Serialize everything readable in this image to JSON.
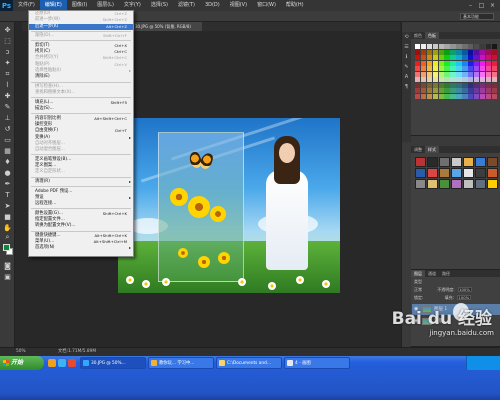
{
  "app": {
    "logo": "Ps",
    "menus": [
      "文件(F)",
      "编辑(E)",
      "图像(I)",
      "图层(L)",
      "文字(Y)",
      "选择(S)",
      "滤镜(T)",
      "3D(D)",
      "视图(V)",
      "窗口(W)",
      "帮助(H)"
    ],
    "active_menu_index": 1,
    "window_controls": [
      "–",
      "□",
      "×"
    ]
  },
  "optbar": {
    "workspace": "基本功能"
  },
  "document": {
    "tab_title": "30.JPG @ 50% (背景, RGB/8)"
  },
  "edit_menu": {
    "items": [
      {
        "label": "还原(O)",
        "shortcut": "Ctrl+Z",
        "state": "disabled"
      },
      {
        "label": "前进一步(W)",
        "shortcut": "Shift+Ctrl+Z",
        "state": "disabled"
      },
      {
        "label": "后退一步(K)",
        "shortcut": "Alt+Ctrl+Z",
        "state": "highlight"
      },
      {
        "sep": true
      },
      {
        "label": "渐隐(D)...",
        "shortcut": "Shift+Ctrl+F",
        "state": "disabled"
      },
      {
        "sep": true
      },
      {
        "label": "剪切(T)",
        "shortcut": "Ctrl+X",
        "state": "normal"
      },
      {
        "label": "拷贝(C)",
        "shortcut": "Ctrl+C",
        "state": "normal"
      },
      {
        "label": "合并拷贝(Y)",
        "shortcut": "Shift+Ctrl+C",
        "state": "disabled"
      },
      {
        "label": "粘贴(P)",
        "shortcut": "Ctrl+V",
        "state": "disabled"
      },
      {
        "label": "选择性粘贴(I)",
        "submenu": true,
        "state": "disabled"
      },
      {
        "label": "清除(E)",
        "state": "normal"
      },
      {
        "sep": true
      },
      {
        "label": "拼写检查(H)...",
        "state": "disabled"
      },
      {
        "label": "查找和替换文本(X)...",
        "state": "disabled"
      },
      {
        "sep": true
      },
      {
        "label": "填充(L)...",
        "shortcut": "Shift+F5",
        "state": "normal"
      },
      {
        "label": "描边(S)...",
        "state": "normal"
      },
      {
        "sep": true
      },
      {
        "label": "内容识别比例",
        "shortcut": "Alt+Shift+Ctrl+C",
        "state": "normal"
      },
      {
        "label": "操控变形",
        "state": "normal"
      },
      {
        "label": "自由变换(F)",
        "shortcut": "Ctrl+T",
        "state": "normal"
      },
      {
        "label": "变换(A)",
        "submenu": true,
        "state": "normal"
      },
      {
        "label": "自动对齐图层...",
        "state": "disabled"
      },
      {
        "label": "自动混合图层...",
        "state": "disabled"
      },
      {
        "sep": true
      },
      {
        "label": "定义画笔预设(B)...",
        "state": "normal"
      },
      {
        "label": "定义图案...",
        "state": "normal"
      },
      {
        "label": "定义自定形状...",
        "state": "disabled"
      },
      {
        "sep": true
      },
      {
        "label": "清理(R)",
        "submenu": true,
        "state": "normal"
      },
      {
        "sep": true
      },
      {
        "label": "Adobe PDF 预设...",
        "state": "normal"
      },
      {
        "label": "预设",
        "submenu": true,
        "state": "normal"
      },
      {
        "label": "远程连接...",
        "state": "normal"
      },
      {
        "sep": true
      },
      {
        "label": "颜色设置(G)...",
        "shortcut": "Shift+Ctrl+K",
        "state": "normal"
      },
      {
        "label": "指定配置文件...",
        "state": "normal"
      },
      {
        "label": "转换为配置文件(V)...",
        "state": "normal"
      },
      {
        "sep": true
      },
      {
        "label": "键盘快捷键...",
        "shortcut": "Alt+Shift+Ctrl+K",
        "state": "normal"
      },
      {
        "label": "菜单(U)...",
        "shortcut": "Alt+Shift+Ctrl+M",
        "state": "normal"
      },
      {
        "label": "首选项(N)",
        "submenu": true,
        "state": "normal"
      }
    ]
  },
  "panels": {
    "color": {
      "tabs": [
        "颜色",
        "色板"
      ],
      "active": 1
    },
    "adjust": {
      "tabs": [
        "调整",
        "样式"
      ],
      "active": 1
    },
    "layers": {
      "tabs": [
        "图层",
        "通道",
        "路径"
      ],
      "kind": "类型",
      "blend": "正常",
      "opacity_label": "不透明度:",
      "opacity": "100%",
      "fill_label": "填充:",
      "fill": "100%",
      "lock_label": "锁定:",
      "rows": [
        {
          "name": "图层 1",
          "selected": true
        },
        {
          "name": "背景",
          "selected": false
        }
      ]
    }
  },
  "status": {
    "zoom": "50%",
    "doc_size": "文档:1.71M/5.89M"
  },
  "taskbar": {
    "start": "开始",
    "buttons": [
      {
        "label": "30.JPG @ 50%...",
        "active": true
      },
      {
        "label": "教你玩... 学习中...",
        "active": false
      },
      {
        "label": "C:\\Documents and...",
        "active": false
      },
      {
        "label": "4 - 画图",
        "active": false
      }
    ]
  },
  "watermark": {
    "brand": "Bai du 经验",
    "url": "jingyan.baidu.com"
  },
  "colors": {
    "menu_highlight": "#1c5fb2",
    "item_highlight": "#3a76c8",
    "layer_selected": "#5a7ea8",
    "taskbar": "#245edb"
  }
}
